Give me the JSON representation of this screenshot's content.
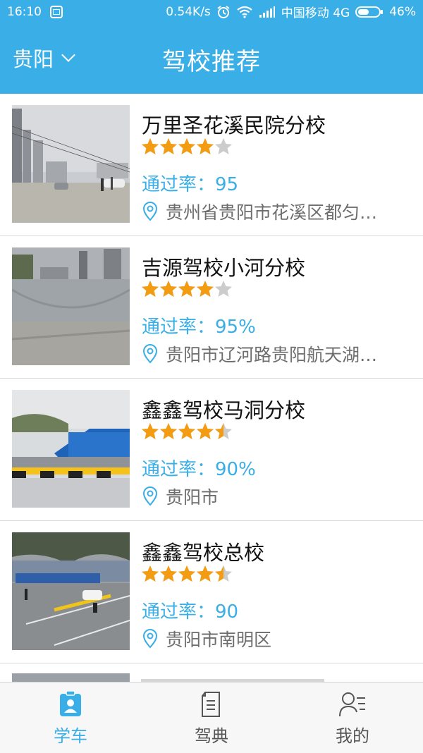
{
  "status_bar": {
    "time": "16:10",
    "speed": "0.54K/s",
    "carrier": "中国移动 4G",
    "battery": "46%"
  },
  "header": {
    "city": "贵阳",
    "title": "驾校推荐"
  },
  "schools": [
    {
      "name": "万里圣花溪民院分校",
      "rating": 4,
      "pass_rate": "通过率：95",
      "address": "贵州省贵阳市花溪区都匀…"
    },
    {
      "name": "吉源驾校小河分校",
      "rating": 4,
      "pass_rate": "通过率：95%",
      "address": "贵阳市辽河路贵阳航天湖…"
    },
    {
      "name": "鑫鑫驾校马洞分校",
      "rating": 4.5,
      "pass_rate": "通过率：90%",
      "address": "贵阳市"
    },
    {
      "name": "鑫鑫驾校总校",
      "rating": 4.5,
      "pass_rate": "通过率：90",
      "address": "贵阳市南明区"
    }
  ],
  "tabs": [
    {
      "label": "学车",
      "active": true
    },
    {
      "label": "驾典",
      "active": false
    },
    {
      "label": "我的",
      "active": false
    }
  ],
  "colors": {
    "accent": "#3aaee6",
    "star": "#f39c12",
    "star_empty": "#cccccc"
  }
}
